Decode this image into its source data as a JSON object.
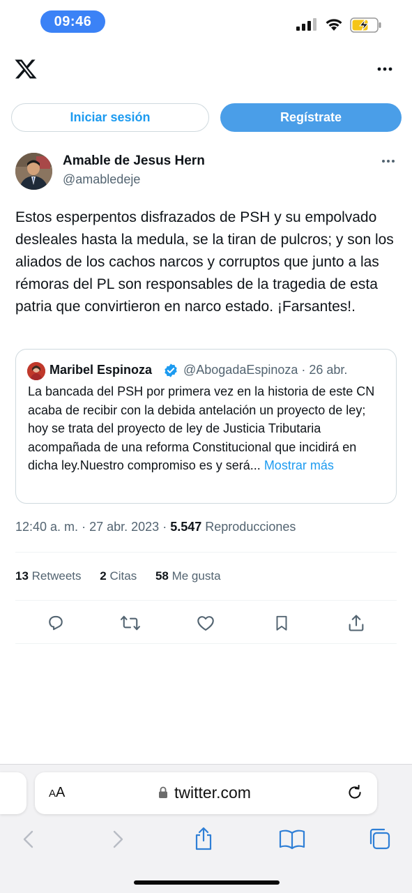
{
  "status_bar": {
    "time": "09:46"
  },
  "header": {
    "logo": "x-logo-icon",
    "more": "more-icon"
  },
  "auth": {
    "login_label": "Iniciar sesión",
    "signup_label": "Regístrate"
  },
  "tweet": {
    "author_name": "Amable de Jesus Hern",
    "author_handle": "@amabledeje",
    "text": "Estos esperpentos disfrazados de PSH y su empolvado desleales hasta la medula, se la tiran de pulcros;  y son los aliados de los cachos narcos y corruptos que junto a las rémoras del PL son responsables de la tragedia de esta patria que convirtieron en narco estado. ¡Farsantes!.",
    "time": "12:40 a. m.",
    "date": "27 abr. 2023",
    "views_count": "5.547",
    "views_label": "Reproducciones",
    "sep": "·"
  },
  "quote": {
    "name": "Maribel Espinoza",
    "handle": "@AbogadaEspinoza · 26 abr.",
    "text": "La bancada del PSH por primera vez en la historia de este CN acaba de recibir con la debida antelación un proyecto de ley; hoy se trata del proyecto de ley de Justicia Tributaria acompañada de una reforma Constitucional que incidirá en dicha ley.Nuestro compromiso es y será...",
    "more_label": "Mostrar más"
  },
  "stats": {
    "retweets_count": "13",
    "retweets_label": "Retweets",
    "quotes_count": "2",
    "quotes_label": "Citas",
    "likes_count": "58",
    "likes_label": "Me gusta"
  },
  "browser": {
    "aa_small": "A",
    "aa_large": "A",
    "url": "twitter.com"
  },
  "colors": {
    "accent": "#1d9bf0",
    "signup": "#4a9ee8",
    "time_pill": "#3b82f6"
  }
}
